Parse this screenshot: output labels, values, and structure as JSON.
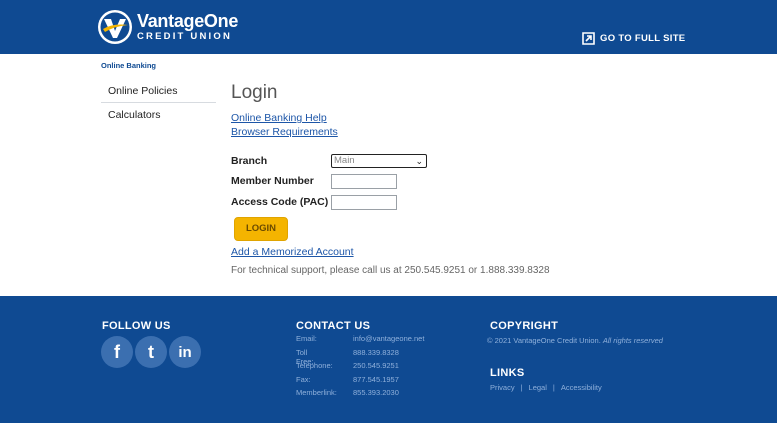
{
  "header": {
    "logo_name": "VantageOne",
    "logo_sub": "CREDIT UNION",
    "full_site_label": "GO TO FULL SITE"
  },
  "breadcrumb": "Online Banking",
  "sidebar": {
    "items": [
      {
        "label": "Online Policies"
      },
      {
        "label": "Calculators"
      }
    ]
  },
  "main": {
    "title": "Login",
    "links": [
      {
        "label": "Online Banking Help"
      },
      {
        "label": "Browser Requirements"
      }
    ]
  },
  "form": {
    "branch_label": "Branch",
    "branch_value": "Main",
    "member_label": "Member Number",
    "member_value": "",
    "access_label": "Access Code (PAC)",
    "access_value": "",
    "login_button": "LOGIN",
    "memorized_link": "Add a Memorized Account",
    "support_text": "For technical support, please call us at 250.545.9251 or 1.888.339.8328"
  },
  "footer": {
    "follow_title": "FOLLOW US",
    "social": [
      {
        "label": "f",
        "icon": "facebook-icon"
      },
      {
        "label": "t",
        "icon": "twitter-icon"
      },
      {
        "label": "in",
        "icon": "linkedin-icon"
      }
    ],
    "contact_title": "CONTACT US",
    "contact": [
      {
        "key": "Email:",
        "value": "info@vantageone.net"
      },
      {
        "key": "Toll Free:",
        "value": "888.339.8328"
      },
      {
        "key": "Telephone:",
        "value": "250.545.9251"
      },
      {
        "key": "Fax:",
        "value": "877.545.1957"
      },
      {
        "key": "Memberlink:",
        "value": "855.393.2030"
      }
    ],
    "copyright_title": "COPYRIGHT",
    "copyright_text": "© 2021 VantageOne Credit Union.",
    "copyright_rights": "All rights reserved",
    "links_title": "LINKS",
    "links": [
      {
        "label": "Privacy"
      },
      {
        "label": "Legal"
      },
      {
        "label": "Accessibility"
      }
    ]
  },
  "colors": {
    "brand_blue": "#0f4a92",
    "accent_yellow": "#f4b400",
    "link_blue": "#1d56a8"
  }
}
